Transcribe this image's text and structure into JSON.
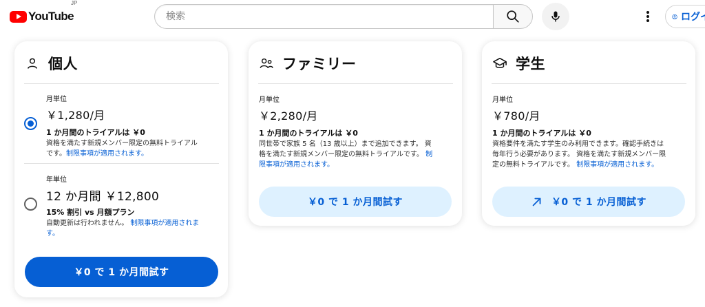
{
  "header": {
    "logo_text": "YouTube",
    "country_code": "JP",
    "search_placeholder": "検索",
    "signin_label": "ログイン",
    "icons": [
      "search-icon",
      "mic-icon",
      "more-vert-icon",
      "account-circle-icon"
    ]
  },
  "plans": {
    "individual": {
      "title": "個人",
      "icon": "person-icon",
      "options": [
        {
          "period": "月単位",
          "price": "￥1,280/月",
          "trial": "1 か月間のトライアルは ￥0",
          "desc_lines": [
            "資格を満たす新規メンバー限定の無料トライアル",
            "です。"
          ],
          "link": "制限事項が適用されます。",
          "selected": true
        },
        {
          "period": "年単位",
          "price": "12 か月間 ￥12,800",
          "trial": "15% 割引 vs 月額プラン",
          "desc_lines": [
            "自動更新は行われません。"
          ],
          "link_lines": [
            "制限事項が適用されま",
            "す。"
          ],
          "selected": false
        }
      ],
      "cta": "￥0 で 1 か月間試す"
    },
    "family": {
      "title": "ファミリー",
      "icon": "family-icon",
      "period": "月単位",
      "price": "￥2,280/月",
      "trial": "1 か月間のトライアルは ￥0",
      "desc_lines": [
        "同世帯で家族 5 名（13 歳以上）まで追加できます。 資",
        "格を満たす新規メンバー限定の無料トライアルです。"
      ],
      "link_lines": [
        "制",
        "限事項が適用されます。"
      ],
      "cta": "￥0 で 1 か月間試す"
    },
    "student": {
      "title": "学生",
      "icon": "school-icon",
      "period": "月単位",
      "price": "￥780/月",
      "trial": "1 か月間のトライアルは ￥0",
      "desc_lines": [
        "資格要件を満たす学生のみ利用できます。確認手続きは",
        "毎年行う必要があります。 資格を満たす新規メンバー限",
        "定の無料トライアルです。"
      ],
      "link": "制限事項が適用されます。",
      "cta": "￥0 で 1 か月間試す",
      "cta_icon": "open-external-icon"
    }
  },
  "colors": {
    "brand_red": "#ff0000",
    "accent_blue": "#065fd4",
    "secondary_btn_bg": "#def1ff"
  }
}
